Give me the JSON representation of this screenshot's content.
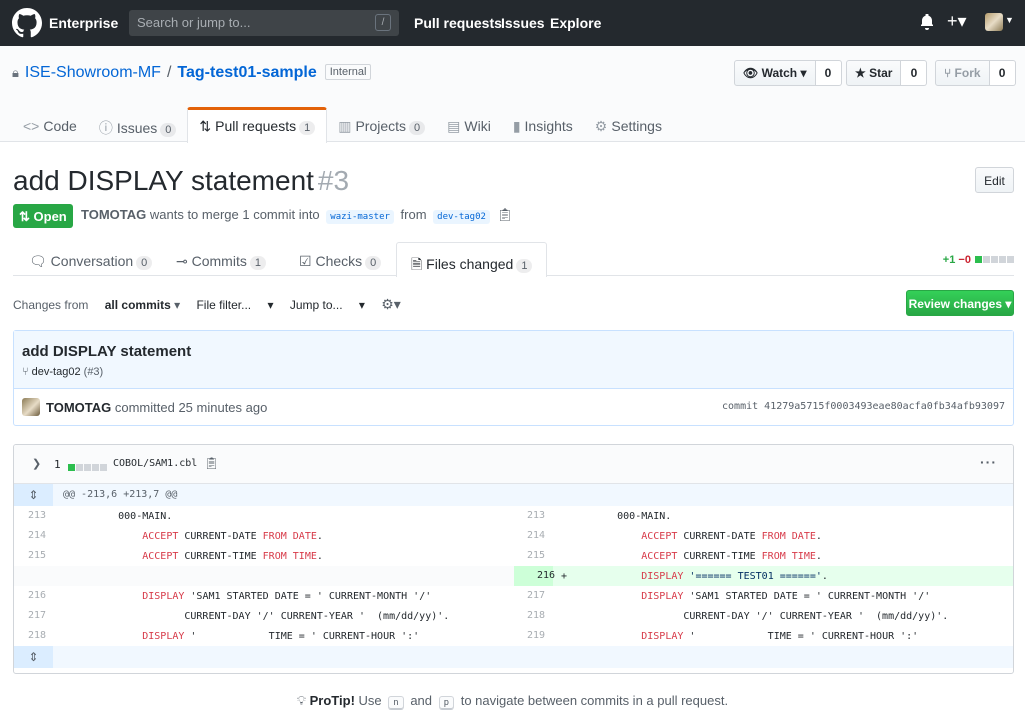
{
  "header": {
    "brand": "Enterprise",
    "search_placeholder": "Search or jump to...",
    "search_key": "/",
    "nav": [
      "Pull requests",
      "Issues",
      "Explore"
    ]
  },
  "repo": {
    "owner": "ISE-Showroom-MF",
    "name": "Tag-test01-sample",
    "visibility": "Internal",
    "watch_label": "Watch",
    "watch_count": "0",
    "star_label": "Star",
    "star_count": "0",
    "fork_label": "Fork",
    "fork_count": "0",
    "tabs": [
      {
        "label": "Code",
        "count": ""
      },
      {
        "label": "Issues",
        "count": "0"
      },
      {
        "label": "Pull requests",
        "count": "1"
      },
      {
        "label": "Projects",
        "count": "0"
      },
      {
        "label": "Wiki",
        "count": ""
      },
      {
        "label": "Insights",
        "count": ""
      },
      {
        "label": "Settings",
        "count": ""
      }
    ]
  },
  "pr": {
    "title": "add DISPLAY statement",
    "number": "#3",
    "edit_label": "Edit",
    "state": "Open",
    "author": "TOMOTAG",
    "merge_text": "wants to merge 1 commit into",
    "base": "wazi-master",
    "from_text": "from",
    "head": "dev-tag02",
    "tabs": [
      {
        "label": "Conversation",
        "count": "0"
      },
      {
        "label": "Commits",
        "count": "1"
      },
      {
        "label": "Checks",
        "count": "0"
      },
      {
        "label": "Files changed",
        "count": "1"
      }
    ],
    "additions": "+1",
    "deletions": "−0"
  },
  "toolbar": {
    "changes_from": "Changes from",
    "all_commits": "all commits",
    "file_filter": "File filter...",
    "jump_to": "Jump to...",
    "review_label": "Review changes"
  },
  "commit": {
    "title": "add DISPLAY statement",
    "branch": "dev-tag02",
    "branch_ref": "(#3)",
    "author": "TOMOTAG",
    "action": "committed 25 minutes ago",
    "sha_label": "commit",
    "sha": "41279a5715f0003493eae80acfa0fb34afb93097"
  },
  "file": {
    "changes": "1",
    "path": "COBOL/SAM1.cbl",
    "hunk": "@@ -213,6 +213,7 @@",
    "left_numbers": [
      "213",
      "214",
      "215",
      "",
      "216",
      "217",
      "218"
    ],
    "right_numbers": [
      "213",
      "214",
      "215",
      "216",
      "217",
      "218",
      "219"
    ],
    "added_marker": "+"
  },
  "protip": {
    "label": "ProTip!",
    "pre": "Use",
    "key1": "n",
    "and": "and",
    "key2": "p",
    "post": "to navigate between commits in a pull request."
  },
  "colors": {
    "header_bg": "#24292e",
    "open_green": "#28a745",
    "link_blue": "#0366d6",
    "keyword_red": "#d73a49",
    "addition_bg": "#e6ffed",
    "tab_accent": "#e36209"
  }
}
